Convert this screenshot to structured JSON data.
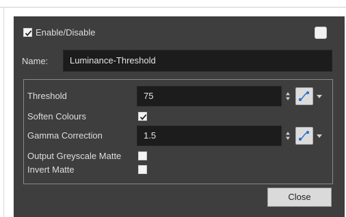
{
  "enable": {
    "label": "Enable/Disable",
    "checked": true
  },
  "name": {
    "label": "Name:",
    "value": "Luminance-Threshold"
  },
  "params": {
    "threshold": {
      "label": "Threshold",
      "value": "75"
    },
    "soften_colours": {
      "label": "Soften Colours",
      "checked": true
    },
    "gamma": {
      "label": "Gamma Correction",
      "value": "1.5"
    },
    "output_greyscale": {
      "label": "Output Greyscale Matte",
      "checked": false
    },
    "invert_matte": {
      "label": "Invert Matte",
      "checked": false
    }
  },
  "close_label": "Close",
  "icons": {
    "spin": "up-down-spinner-icon",
    "curve": "function-curve-icon",
    "dropdown": "chevron-down-icon"
  },
  "colors": {
    "dialog_bg": "#3e3e3e",
    "field_bg": "#1c1c1c",
    "curve_blue": "#2d6fd0"
  }
}
